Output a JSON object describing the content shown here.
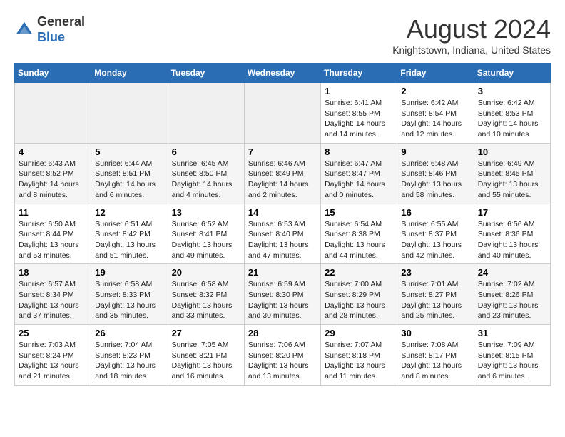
{
  "header": {
    "logo_line1": "General",
    "logo_line2": "Blue",
    "month": "August 2024",
    "location": "Knightstown, Indiana, United States"
  },
  "days_of_week": [
    "Sunday",
    "Monday",
    "Tuesday",
    "Wednesday",
    "Thursday",
    "Friday",
    "Saturday"
  ],
  "weeks": [
    [
      {
        "day": "",
        "info": ""
      },
      {
        "day": "",
        "info": ""
      },
      {
        "day": "",
        "info": ""
      },
      {
        "day": "",
        "info": ""
      },
      {
        "day": "1",
        "info": "Sunrise: 6:41 AM\nSunset: 8:55 PM\nDaylight: 14 hours and 14 minutes."
      },
      {
        "day": "2",
        "info": "Sunrise: 6:42 AM\nSunset: 8:54 PM\nDaylight: 14 hours and 12 minutes."
      },
      {
        "day": "3",
        "info": "Sunrise: 6:42 AM\nSunset: 8:53 PM\nDaylight: 14 hours and 10 minutes."
      }
    ],
    [
      {
        "day": "4",
        "info": "Sunrise: 6:43 AM\nSunset: 8:52 PM\nDaylight: 14 hours and 8 minutes."
      },
      {
        "day": "5",
        "info": "Sunrise: 6:44 AM\nSunset: 8:51 PM\nDaylight: 14 hours and 6 minutes."
      },
      {
        "day": "6",
        "info": "Sunrise: 6:45 AM\nSunset: 8:50 PM\nDaylight: 14 hours and 4 minutes."
      },
      {
        "day": "7",
        "info": "Sunrise: 6:46 AM\nSunset: 8:49 PM\nDaylight: 14 hours and 2 minutes."
      },
      {
        "day": "8",
        "info": "Sunrise: 6:47 AM\nSunset: 8:47 PM\nDaylight: 14 hours and 0 minutes."
      },
      {
        "day": "9",
        "info": "Sunrise: 6:48 AM\nSunset: 8:46 PM\nDaylight: 13 hours and 58 minutes."
      },
      {
        "day": "10",
        "info": "Sunrise: 6:49 AM\nSunset: 8:45 PM\nDaylight: 13 hours and 55 minutes."
      }
    ],
    [
      {
        "day": "11",
        "info": "Sunrise: 6:50 AM\nSunset: 8:44 PM\nDaylight: 13 hours and 53 minutes."
      },
      {
        "day": "12",
        "info": "Sunrise: 6:51 AM\nSunset: 8:42 PM\nDaylight: 13 hours and 51 minutes."
      },
      {
        "day": "13",
        "info": "Sunrise: 6:52 AM\nSunset: 8:41 PM\nDaylight: 13 hours and 49 minutes."
      },
      {
        "day": "14",
        "info": "Sunrise: 6:53 AM\nSunset: 8:40 PM\nDaylight: 13 hours and 47 minutes."
      },
      {
        "day": "15",
        "info": "Sunrise: 6:54 AM\nSunset: 8:38 PM\nDaylight: 13 hours and 44 minutes."
      },
      {
        "day": "16",
        "info": "Sunrise: 6:55 AM\nSunset: 8:37 PM\nDaylight: 13 hours and 42 minutes."
      },
      {
        "day": "17",
        "info": "Sunrise: 6:56 AM\nSunset: 8:36 PM\nDaylight: 13 hours and 40 minutes."
      }
    ],
    [
      {
        "day": "18",
        "info": "Sunrise: 6:57 AM\nSunset: 8:34 PM\nDaylight: 13 hours and 37 minutes."
      },
      {
        "day": "19",
        "info": "Sunrise: 6:58 AM\nSunset: 8:33 PM\nDaylight: 13 hours and 35 minutes."
      },
      {
        "day": "20",
        "info": "Sunrise: 6:58 AM\nSunset: 8:32 PM\nDaylight: 13 hours and 33 minutes."
      },
      {
        "day": "21",
        "info": "Sunrise: 6:59 AM\nSunset: 8:30 PM\nDaylight: 13 hours and 30 minutes."
      },
      {
        "day": "22",
        "info": "Sunrise: 7:00 AM\nSunset: 8:29 PM\nDaylight: 13 hours and 28 minutes."
      },
      {
        "day": "23",
        "info": "Sunrise: 7:01 AM\nSunset: 8:27 PM\nDaylight: 13 hours and 25 minutes."
      },
      {
        "day": "24",
        "info": "Sunrise: 7:02 AM\nSunset: 8:26 PM\nDaylight: 13 hours and 23 minutes."
      }
    ],
    [
      {
        "day": "25",
        "info": "Sunrise: 7:03 AM\nSunset: 8:24 PM\nDaylight: 13 hours and 21 minutes."
      },
      {
        "day": "26",
        "info": "Sunrise: 7:04 AM\nSunset: 8:23 PM\nDaylight: 13 hours and 18 minutes."
      },
      {
        "day": "27",
        "info": "Sunrise: 7:05 AM\nSunset: 8:21 PM\nDaylight: 13 hours and 16 minutes."
      },
      {
        "day": "28",
        "info": "Sunrise: 7:06 AM\nSunset: 8:20 PM\nDaylight: 13 hours and 13 minutes."
      },
      {
        "day": "29",
        "info": "Sunrise: 7:07 AM\nSunset: 8:18 PM\nDaylight: 13 hours and 11 minutes."
      },
      {
        "day": "30",
        "info": "Sunrise: 7:08 AM\nSunset: 8:17 PM\nDaylight: 13 hours and 8 minutes."
      },
      {
        "day": "31",
        "info": "Sunrise: 7:09 AM\nSunset: 8:15 PM\nDaylight: 13 hours and 6 minutes."
      }
    ]
  ]
}
